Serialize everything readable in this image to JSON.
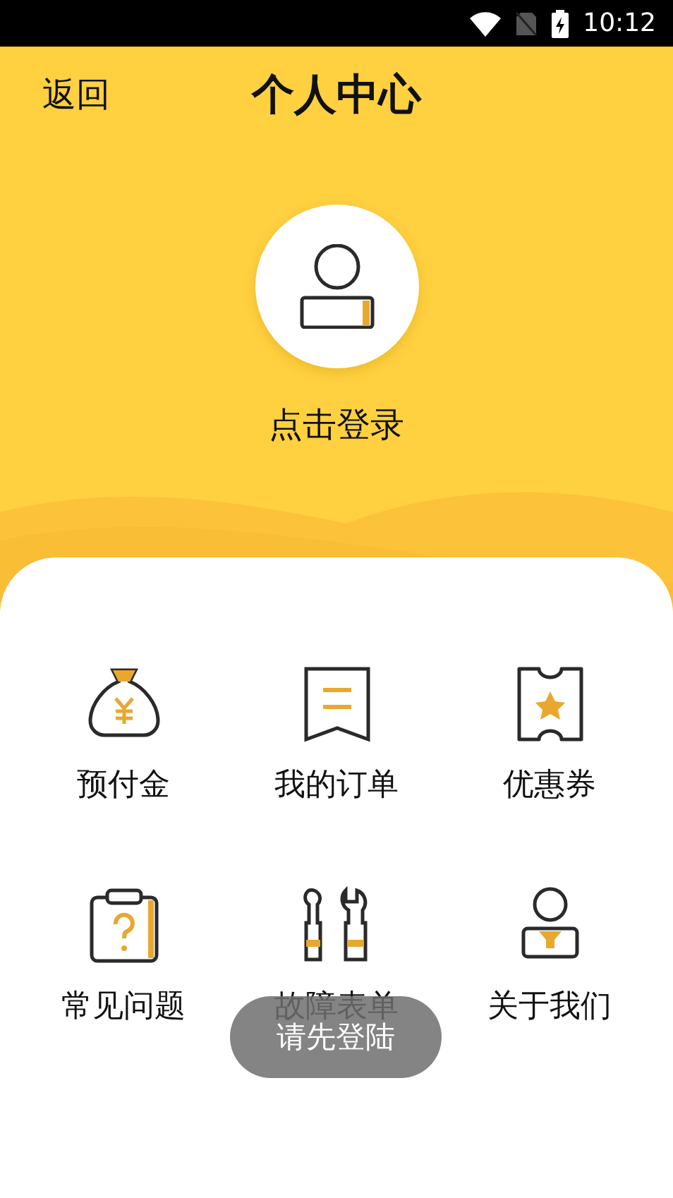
{
  "status_bar": {
    "time": "10:12"
  },
  "header": {
    "back": "返回",
    "title": "个人中心"
  },
  "profile": {
    "login": "点击登录"
  },
  "menu": [
    {
      "label": "预付金"
    },
    {
      "label": "我的订单"
    },
    {
      "label": "优惠券"
    },
    {
      "label": "常见问题"
    },
    {
      "label": "故障表单"
    },
    {
      "label": "关于我们"
    }
  ],
  "toast": {
    "text": "请先登陆"
  }
}
